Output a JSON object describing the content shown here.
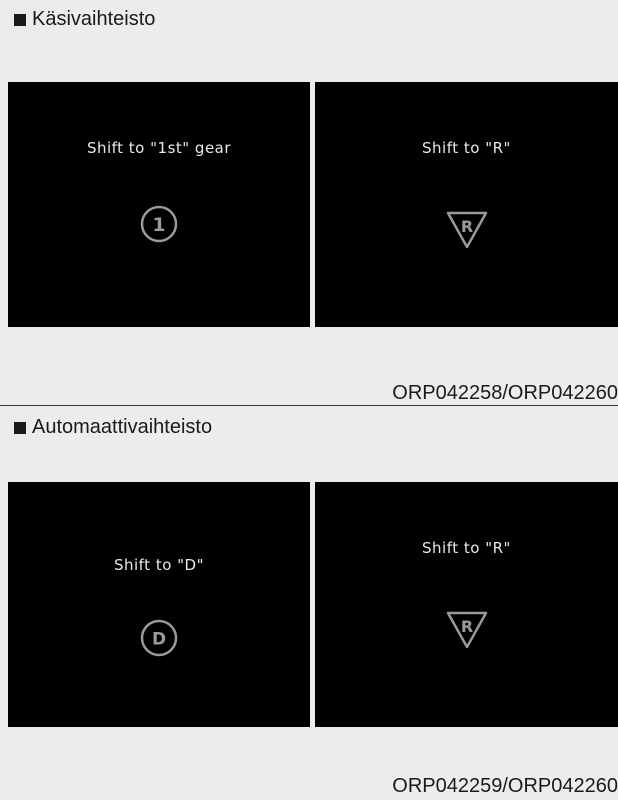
{
  "sections": [
    {
      "title": "Käsivaihteisto",
      "panels": [
        {
          "text": "Shift to \"1st\" gear",
          "icon": "gear-1-circle-icon",
          "icon_label": "1"
        },
        {
          "text": "Shift to \"R\"",
          "icon": "reverse-triangle-icon",
          "icon_label": "R"
        }
      ],
      "code": "ORP042258/ORP042260"
    },
    {
      "title": "Automaattivaihteisto",
      "panels": [
        {
          "text": "Shift to \"D\"",
          "icon": "drive-circle-icon",
          "icon_label": "D"
        },
        {
          "text": "Shift to \"R\"",
          "icon": "reverse-triangle-icon",
          "icon_label": "R"
        }
      ],
      "code": "ORP042259/ORP042260"
    }
  ],
  "colors": {
    "page_background": "#ececec",
    "panel_background": "#000000",
    "panel_text": "#e8e8e8",
    "icon_stroke": "#9a9a9a"
  }
}
